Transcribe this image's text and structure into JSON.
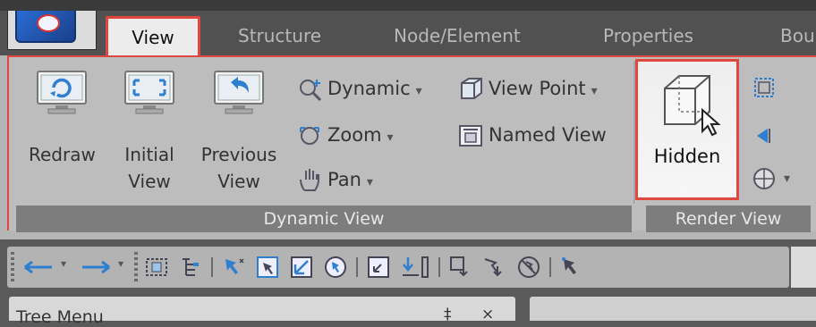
{
  "tabs": [
    "View",
    "Structure",
    "Node/Element",
    "Properties",
    "Bour"
  ],
  "active_tab": "View",
  "ribbon": {
    "dynamic_view": {
      "label": "Dynamic View",
      "big_buttons": [
        {
          "line1": "Redraw",
          "line2": ""
        },
        {
          "line1": "Initial",
          "line2": "View"
        },
        {
          "line1": "Previous",
          "line2": "View"
        }
      ],
      "small_col1": [
        "Dynamic",
        "Zoom",
        "Pan"
      ],
      "small_col2": [
        "View Point",
        "Named View"
      ]
    },
    "render_view": {
      "label": "Render View",
      "hidden_label": "Hidden"
    }
  },
  "bottom": {
    "tree_menu_title": "Tree Menu",
    "pin_glyph": "‡",
    "close_glyph": "×"
  },
  "colors": {
    "highlight": "#e0473f",
    "ribbon_bg": "#bdbdbd",
    "group_label_bg": "#7d7d7d"
  }
}
